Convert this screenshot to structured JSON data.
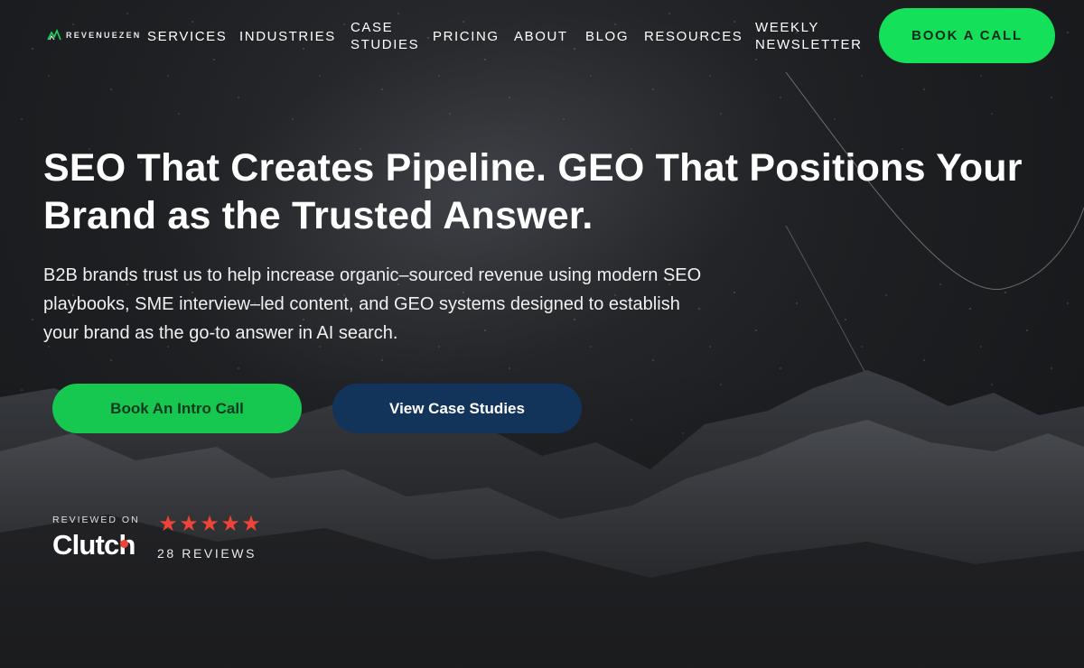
{
  "brand": {
    "name": "REVENUEZEN",
    "accent_green": "#14e05a",
    "navy": "#13345a"
  },
  "nav": {
    "items": [
      {
        "label": "SERVICES"
      },
      {
        "label": "INDUSTRIES"
      },
      {
        "label": "CASE STUDIES"
      },
      {
        "label": "PRICING"
      },
      {
        "label": "ABOUT"
      },
      {
        "label": "BLOG"
      },
      {
        "label": "RESOURCES"
      },
      {
        "label": "WEEKLY NEWSLETTER"
      }
    ],
    "cta_label": "BOOK A CALL"
  },
  "hero": {
    "headline": "SEO That Creates Pipeline. GEO That Positions Your Brand as the Trusted Answer.",
    "subhead": "B2B brands trust us to help increase organic–sourced revenue using modern SEO playbooks, SME interview–led content, and GEO systems designed to establish your brand as the go-to answer in AI search.",
    "primary_button": "Book An Intro Call",
    "secondary_button": "View Case Studies"
  },
  "clutch": {
    "reviewed_on": "REVIEWED ON",
    "wordmark": "Clutch",
    "rating_stars": 5,
    "star_glyph": "★",
    "review_count": "28 REVIEWS",
    "star_color": "#ef4335"
  }
}
